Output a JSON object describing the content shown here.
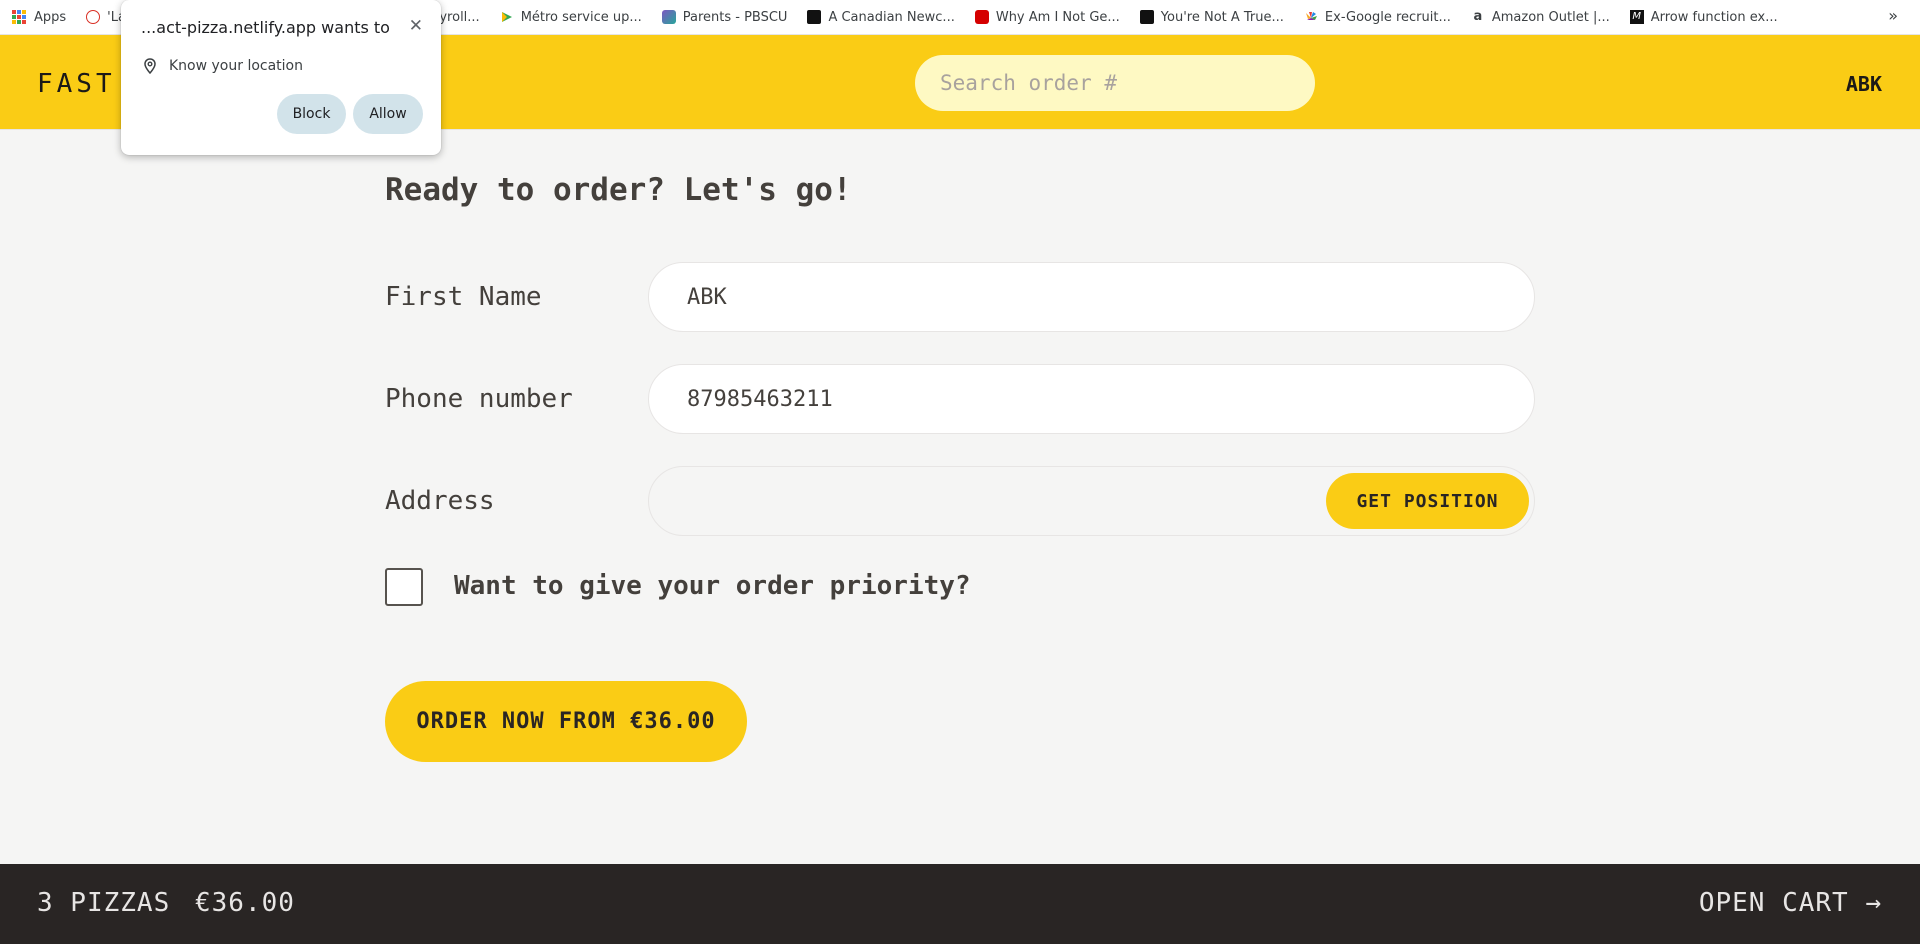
{
  "bookmarks": {
    "apps_label": "Apps",
    "items": [
      {
        "label": "'La",
        "icon": "news-icon",
        "color": "#d93025"
      },
      {
        "label": "adian Payroll...",
        "icon": "payroll-icon",
        "color": "#5f6368"
      },
      {
        "label": "Métro service up...",
        "icon": "metro-icon",
        "color": "#34a853"
      },
      {
        "label": "Parents - PBSCU",
        "icon": "parents-icon",
        "color": "#7e57c2"
      },
      {
        "label": "A Canadian Newc...",
        "icon": "medium-icon",
        "color": "#111111"
      },
      {
        "label": "Why Am I Not Ge...",
        "icon": "rd-icon",
        "color": "#d50000"
      },
      {
        "label": "You're Not A True...",
        "icon": "medium-icon",
        "color": "#111111"
      },
      {
        "label": "Ex-Google recruit...",
        "icon": "nbc-icon",
        "color": "#f9a825"
      },
      {
        "label": "Amazon Outlet |...",
        "icon": "amazon-icon",
        "color": "#ff9900"
      },
      {
        "label": "Arrow function ex...",
        "icon": "mdn-icon",
        "color": "#111111"
      }
    ],
    "overflow": "»"
  },
  "popup": {
    "title": "...act-pizza.netlify.app wants to",
    "permission": "Know your location",
    "block_label": "Block",
    "allow_label": "Allow",
    "close": "✕"
  },
  "header": {
    "logo": "FAST",
    "search_placeholder": "Search order #",
    "user": "ABK"
  },
  "form": {
    "title": "Ready to order? Let's go!",
    "first_name_label": "First Name",
    "first_name_value": "ABK",
    "phone_label": "Phone number",
    "phone_value": "87985463211",
    "address_label": "Address",
    "address_value": "",
    "get_position_label": "GET POSITION",
    "priority_label": "Want to give your order priority?",
    "priority_checked": false,
    "order_button_label": "ORDER NOW FROM €36.00"
  },
  "cart": {
    "count": "3 PIZZAS",
    "total": "€36.00",
    "open_label": "OPEN CART →"
  },
  "colors": {
    "accent": "#facc15",
    "search_bg": "#fef9c3",
    "footer_bg": "#292524",
    "page_bg": "#f5f5f4"
  }
}
